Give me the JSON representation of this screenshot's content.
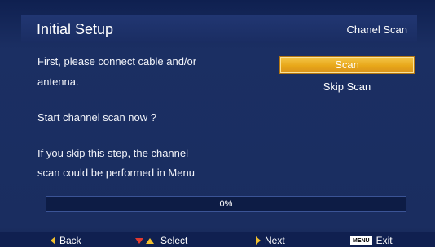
{
  "header": {
    "title": "Initial Setup",
    "right_label": "Chanel Scan"
  },
  "body": {
    "line1": "First, please connect cable and/or",
    "line2": "antenna.",
    "line3": "Start channel scan now ?",
    "line4": "If you skip this step, the channel",
    "line5": "scan could be performed in Menu"
  },
  "menu": {
    "scan_label": "Scan",
    "skip_label": "Skip Scan",
    "selected": "Scan"
  },
  "progress": {
    "percent_text": "0%",
    "value": 0
  },
  "footer": {
    "back_label": "Back",
    "select_label": "Select",
    "next_label": "Next",
    "menu_key_label": "MENU",
    "exit_label": "Exit"
  },
  "colors": {
    "background": "#1a2c5c",
    "highlight": "#e8a719",
    "footer_arrow_yellow": "#f2c12e",
    "footer_arrow_red": "#e23a2f"
  }
}
